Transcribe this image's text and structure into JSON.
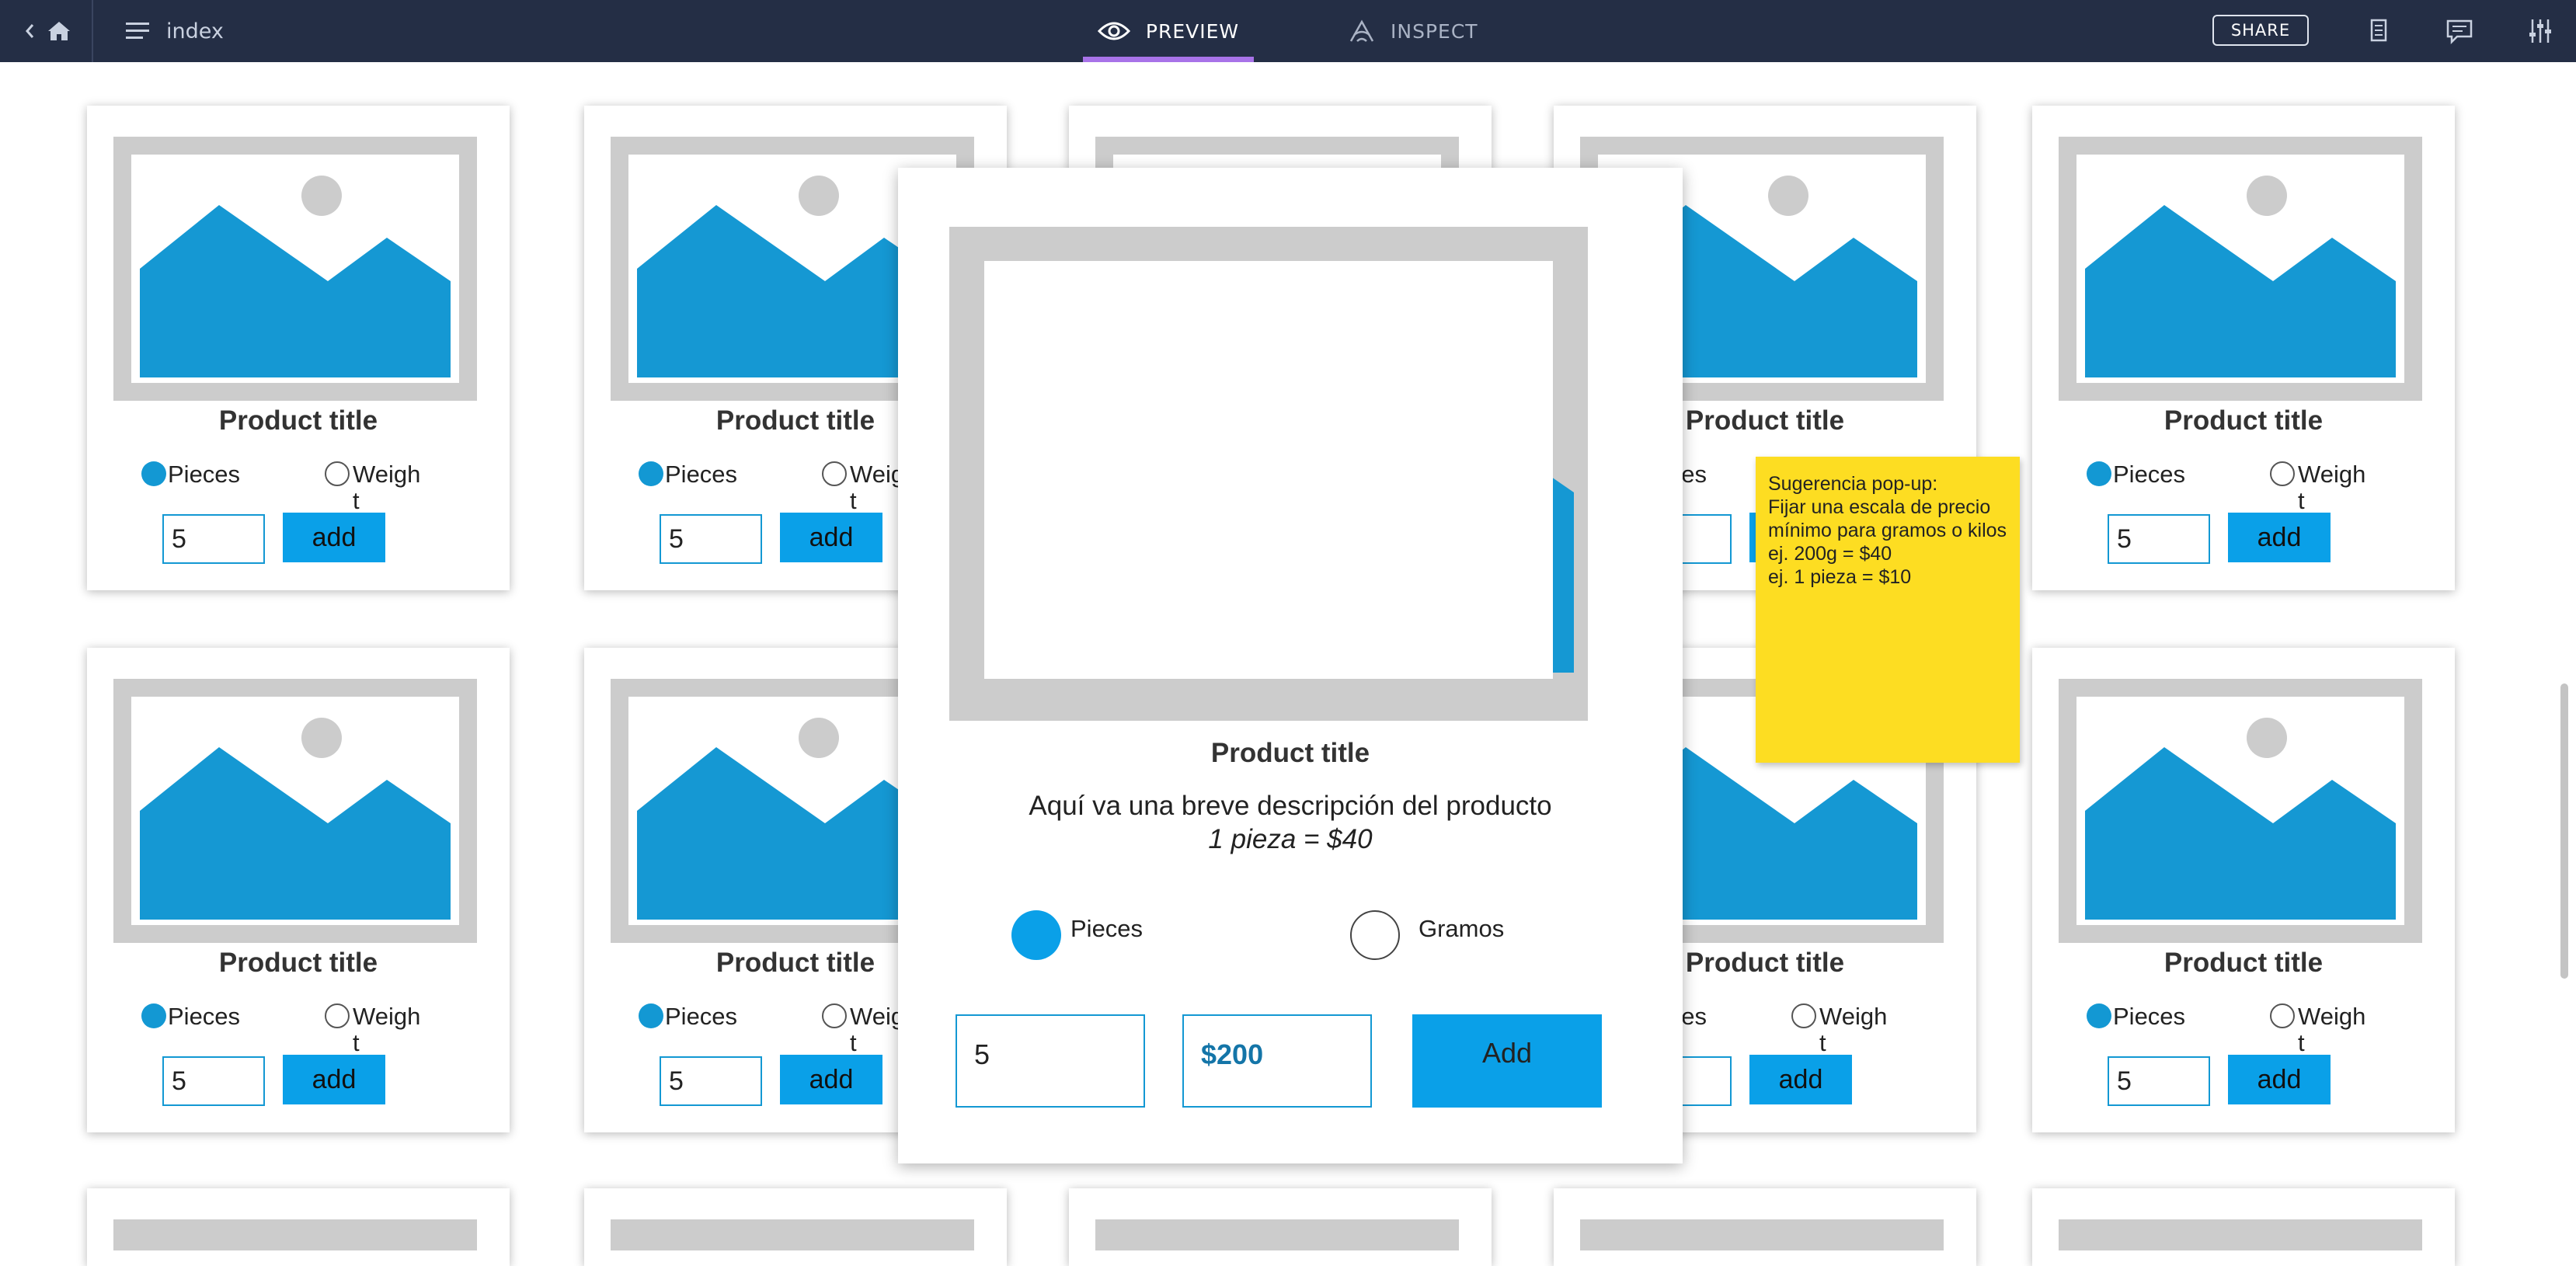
{
  "topbar": {
    "back_icon": "chevron-left-icon",
    "home_icon": "home-icon",
    "menu_icon": "hamburger-icon",
    "page_name": "index",
    "tabs": [
      {
        "label": "PREVIEW",
        "icon": "eye-icon",
        "active": true
      },
      {
        "label": "INSPECT",
        "icon": "inspect-icon",
        "active": false
      }
    ],
    "share_label": "SHARE",
    "right_icons": [
      "document-icon",
      "comment-icon",
      "settings-sliders-icon"
    ],
    "accent_color": "#a873e8",
    "background_color": "#242e45"
  },
  "product_card": {
    "title": "Product title",
    "option_pieces": "Pieces",
    "option_weight": "Weight",
    "quantity": "5",
    "add_label": "add",
    "image_placeholder_icon": "image-placeholder-icon",
    "accent_color": "#1398d3"
  },
  "modal": {
    "title": "Product title",
    "description": "Aquí va una breve descripción del producto",
    "price_note": "1 pieza = $40",
    "option_pieces": "Pieces",
    "option_grams": "Gramos",
    "quantity": "5",
    "price": "$200",
    "add_label": "Add"
  },
  "sticky_note": {
    "text": "Sugerencia pop-up:\nFijar una escala de precio mínimo para gramos o kilos\nej. 200g = $40\nej. 1 pieza = $10",
    "color": "#fddd22"
  }
}
